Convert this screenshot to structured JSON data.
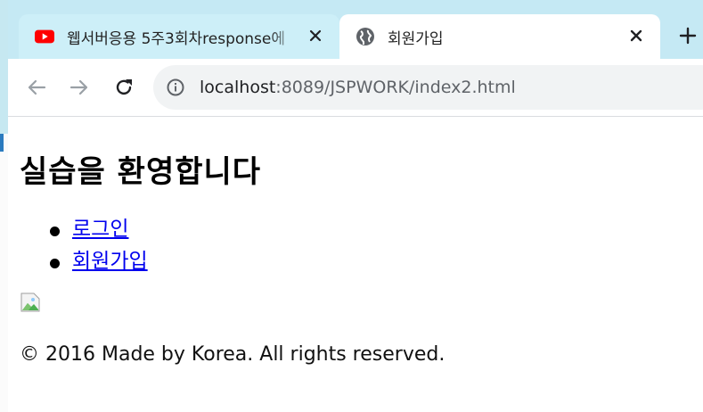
{
  "tabs": [
    {
      "title": "웹서버응용 5주3회차response에",
      "favicon": "youtube-icon",
      "active": false
    },
    {
      "title": "회원가입",
      "favicon": "globe-icon",
      "active": true
    }
  ],
  "toolbar": {
    "url_host": "localhost",
    "url_rest": ":8089/JSPWORK/index2.html"
  },
  "page": {
    "heading": "실습을 환영합니다",
    "links": [
      "로그인",
      "회원가입"
    ],
    "footer": "© 2016 Made by Korea. All rights reserved."
  },
  "colors": {
    "tabstrip": "#c5e9f4",
    "link": "#0000ee",
    "youtube_red": "#ff0000"
  }
}
